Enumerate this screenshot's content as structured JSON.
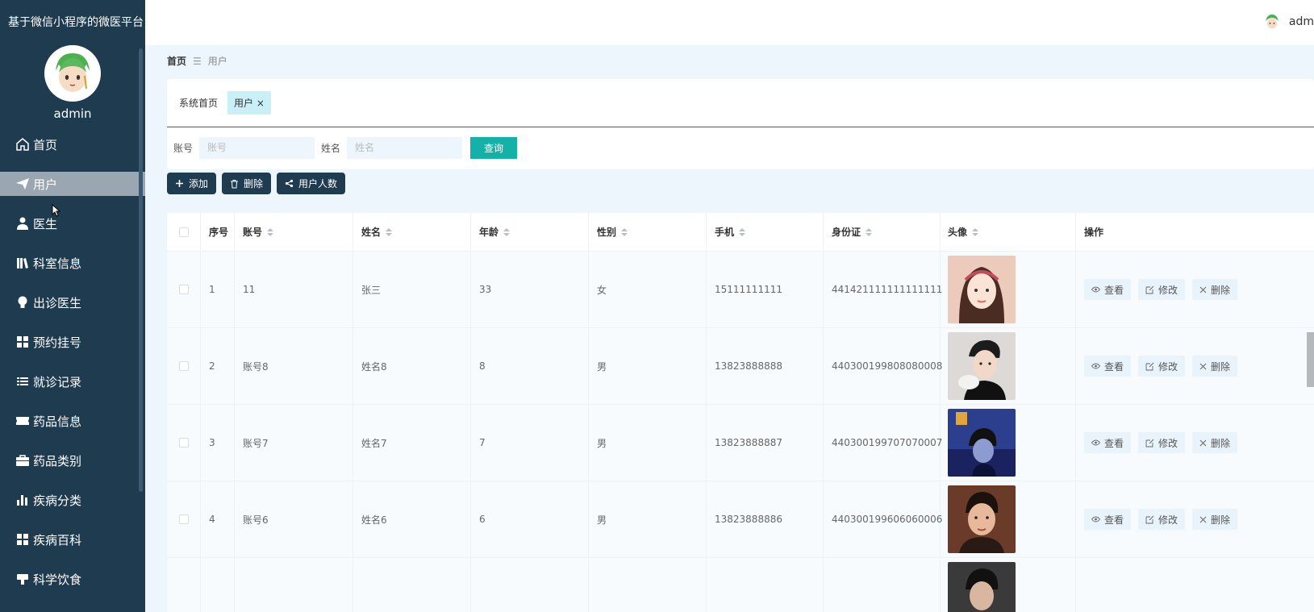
{
  "app": {
    "title": "基于微信小程序的微医平台"
  },
  "sidebar": {
    "username": "admin",
    "items": [
      {
        "label": "首页",
        "icon": "home-icon",
        "active": false
      },
      {
        "label": "用户",
        "icon": "paper-plane-icon",
        "active": true
      },
      {
        "label": "医生",
        "icon": "person-icon",
        "active": false
      },
      {
        "label": "科室信息",
        "icon": "books-icon",
        "active": false
      },
      {
        "label": "出诊医生",
        "icon": "bulb-icon",
        "active": false
      },
      {
        "label": "预约挂号",
        "icon": "grid-icon",
        "active": false
      },
      {
        "label": "就诊记录",
        "icon": "list-icon",
        "active": false
      },
      {
        "label": "药品信息",
        "icon": "ticket-icon",
        "active": false
      },
      {
        "label": "药品类别",
        "icon": "briefcase-icon",
        "active": false
      },
      {
        "label": "疾病分类",
        "icon": "bar-chart-icon",
        "active": false
      },
      {
        "label": "疾病百科",
        "icon": "grid-icon",
        "active": false
      },
      {
        "label": "科学饮食",
        "icon": "food-icon",
        "active": false
      }
    ]
  },
  "topbar": {
    "user": "adm"
  },
  "breadcrumb": {
    "home": "首页",
    "separator": "☰",
    "current": "用户"
  },
  "tabs": [
    {
      "label": "系统首页"
    },
    {
      "label": "用户",
      "close": "×"
    }
  ],
  "search": {
    "account_label": "账号",
    "account_placeholder": "账号",
    "name_label": "姓名",
    "name_placeholder": "姓名",
    "query_label": "查询"
  },
  "actions": {
    "add": "添加",
    "delete": "删除",
    "stats": "用户人数"
  },
  "table": {
    "headers": [
      "序号",
      "账号",
      "姓名",
      "年龄",
      "性别",
      "手机",
      "身份证",
      "头像",
      "操作"
    ],
    "rows": [
      {
        "no": "1",
        "account": "11",
        "name": "张三",
        "age": "33",
        "sex": "女",
        "phone": "15111111111",
        "id": "441421111111111111"
      },
      {
        "no": "2",
        "account": "账号8",
        "name": "姓名8",
        "age": "8",
        "sex": "男",
        "phone": "13823888888",
        "id": "440300199808080008"
      },
      {
        "no": "3",
        "account": "账号7",
        "name": "姓名7",
        "age": "7",
        "sex": "男",
        "phone": "13823888887",
        "id": "440300199707070007"
      },
      {
        "no": "4",
        "account": "账号6",
        "name": "姓名6",
        "age": "6",
        "sex": "男",
        "phone": "13823888886",
        "id": "440300199606060006"
      }
    ],
    "ops": {
      "view": "查看",
      "edit": "修改",
      "delete": "删除"
    }
  },
  "colors": {
    "sidebar_bg": "#1f3b50",
    "accent": "#13b1a8",
    "main_bg": "#edf6fd"
  }
}
